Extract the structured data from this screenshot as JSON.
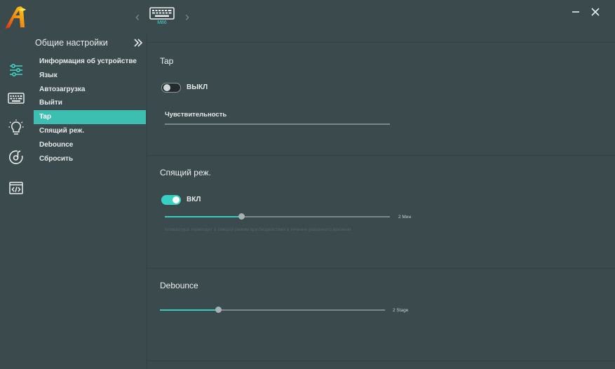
{
  "device": {
    "name": "M86",
    "icon": "keyboard-icon"
  },
  "window": {
    "minimize_icon": "minimize-icon",
    "close_icon": "close-icon"
  },
  "colors": {
    "accent": "#3cbfb0",
    "background": "#3b4a4d",
    "toggle_on": "#37d1c4"
  },
  "iconbar": [
    "settings-sliders-icon",
    "keyboard-icon",
    "lightbulb-icon",
    "music-disc-icon",
    "code-window-icon"
  ],
  "sidebar": {
    "title": "Общие настройки",
    "collapse_icon": "double-chevron-right-icon",
    "items": [
      {
        "label": "Информация об устройстве",
        "active": false
      },
      {
        "label": "Язык",
        "active": false
      },
      {
        "label": "Автозагрузка",
        "active": false
      },
      {
        "label": "Выйти",
        "active": false
      },
      {
        "label": "Tap",
        "active": true
      },
      {
        "label": "Спящий реж.",
        "active": false
      },
      {
        "label": "Debounce",
        "active": false
      },
      {
        "label": "Сбросить",
        "active": false
      }
    ]
  },
  "tap": {
    "title": "Tap",
    "toggle_on": false,
    "toggle_label": "ВЫКЛ",
    "sensitivity_label": "Чувствительность"
  },
  "sleep": {
    "title": "Спящий реж.",
    "toggle_on": true,
    "toggle_label": "ВКЛ",
    "slider_fraction": 0.34,
    "value_label": "2 Мин",
    "hint": "Клавиатура переходит в спящий режим при бездействии в течение указанного времени"
  },
  "debounce": {
    "title": "Debounce",
    "slider_fraction": 0.26,
    "value_label": "2 Stage"
  }
}
